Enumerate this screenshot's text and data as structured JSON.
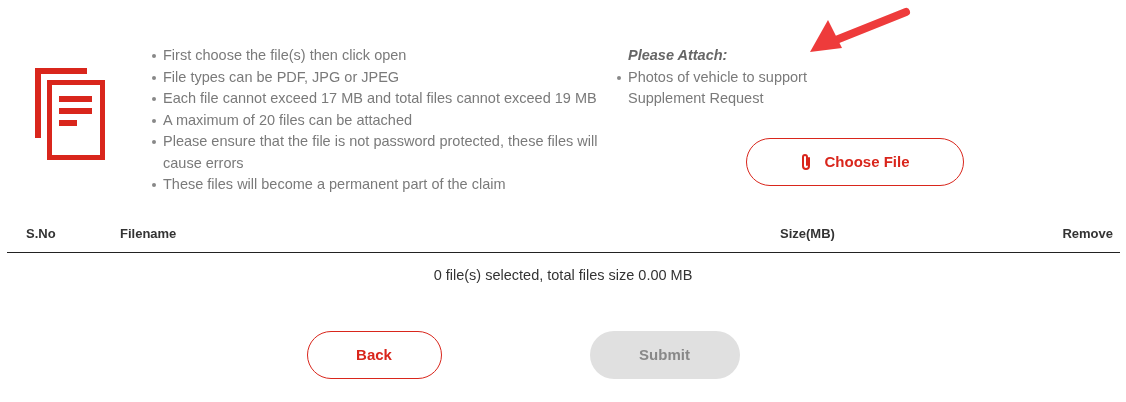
{
  "instructions": [
    "First choose the file(s) then click open",
    "File types can be PDF, JPG or JPEG",
    "Each file cannot exceed 17 MB and total files cannot exceed 19 MB",
    "A maximum of 20 files can be attached",
    "Please ensure that the file is not password protected, these files will cause errors",
    "These files will become a permanent part of the claim"
  ],
  "attach": {
    "heading": "Please Attach:",
    "items": [
      "Photos of vehicle to support Supplement Request"
    ]
  },
  "choose_button": {
    "label": "Choose File"
  },
  "table": {
    "columns": [
      "S.No",
      "Filename",
      "Size(MB)",
      "Remove"
    ]
  },
  "summary": "0 file(s) selected, total files size 0.00 MB",
  "buttons": [
    {
      "label": "Back",
      "disabled": false
    },
    {
      "label": "Submit",
      "disabled": true
    }
  ]
}
